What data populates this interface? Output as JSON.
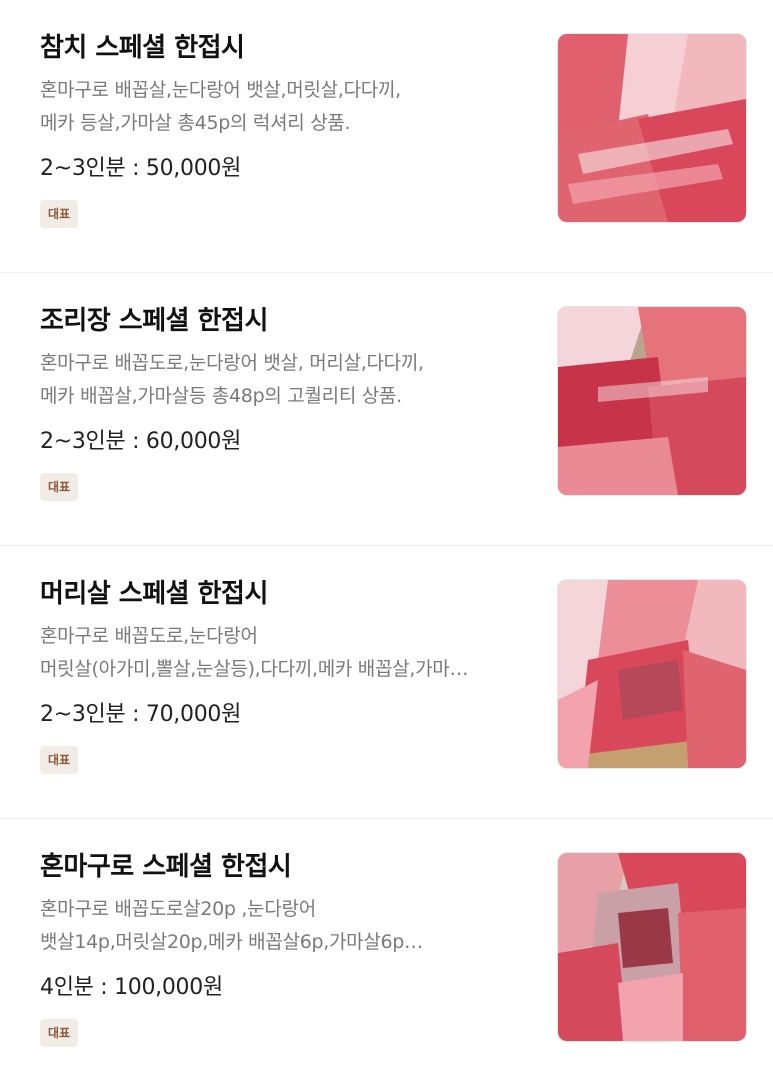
{
  "menu": {
    "items": [
      {
        "title": "참치 스페셜 한접시",
        "desc_line1": "혼마구로 배꼽살,눈다랑어 뱃살,머릿살,다다끼,",
        "desc_line2": "메카 등살,가마살 총45p의 럭셔리 상품.",
        "price": "2~3인분 : 50,000원",
        "badge": "대표",
        "photo_icon": "tuna-sashimi-platter"
      },
      {
        "title": "조리장 스페셜 한접시",
        "desc_line1": "혼마구로 배꼽도로,눈다랑어 뱃살, 머리살,다다끼,",
        "desc_line2": "메카 배꼽살,가마살등 총48p의 고퀄리티 상품.",
        "price": "2~3인분 : 60,000원",
        "badge": "대표",
        "photo_icon": "tuna-sashimi-platter"
      },
      {
        "title": "머리살 스페셜 한접시",
        "desc_line1": "혼마구로 배꼽도로,눈다랑어",
        "desc_line2": "머릿살(아가미,뽈살,눈살등),다다끼,메카 배꼽살,가마…",
        "price": "2~3인분 : 70,000원",
        "badge": "대표",
        "photo_icon": "tuna-sashimi-platter"
      },
      {
        "title": "혼마구로 스페셜 한접시",
        "desc_line1": "혼마구로 배꼽도로살20p ,눈다랑어",
        "desc_line2": "뱃살14p,머릿살20p,메카 배꼽살6p,가마살6p…",
        "price": "4인분 : 100,000원",
        "badge": "대표",
        "photo_icon": "tuna-sashimi-platter"
      }
    ]
  },
  "colors": {
    "badge_bg": "#f1ece6",
    "badge_text": "#8a5a3a",
    "desc_text": "#7a7a7a",
    "tuna_red": "#d9485a",
    "tuna_pink": "#f2a3ad",
    "fat_white": "#f7e4e6"
  }
}
